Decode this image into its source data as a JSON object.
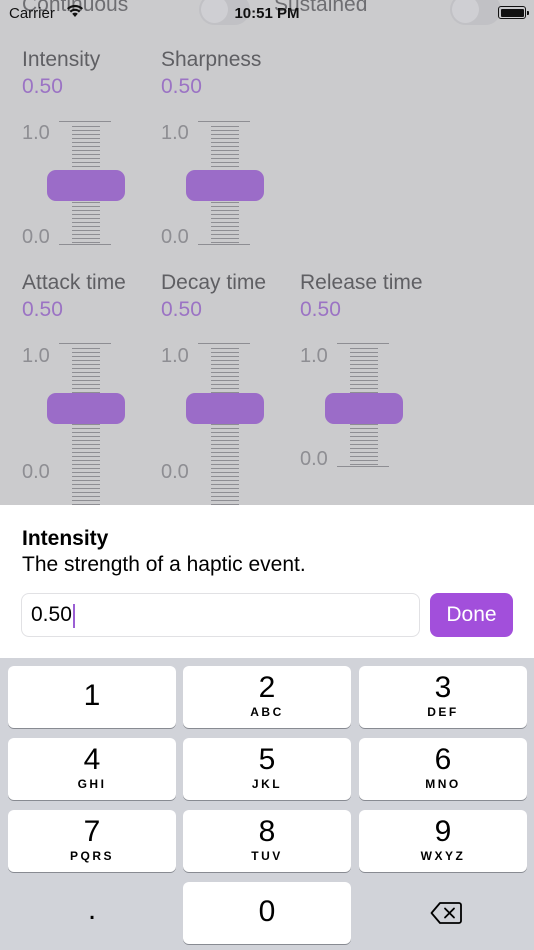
{
  "status": {
    "carrier": "Carrier",
    "time": "10:51 PM"
  },
  "modes": {
    "left": "Continuous",
    "right": "Sustained"
  },
  "params_row1": [
    {
      "name": "Intensity",
      "value": "0.50",
      "max": "1.0",
      "min": "0.0",
      "level": 0.5
    },
    {
      "name": "Sharpness",
      "value": "0.50",
      "max": "1.0",
      "min": "0.0",
      "level": 0.5
    }
  ],
  "params_row2": [
    {
      "name": "Attack time",
      "value": "0.50",
      "max": "1.0",
      "min": "0.0",
      "level": 0.5
    },
    {
      "name": "Decay time",
      "value": "0.50",
      "max": "1.0",
      "min": "0.0",
      "level": 0.5
    },
    {
      "name": "Release time",
      "value": "0.50",
      "max": "1.0",
      "min": "0.0",
      "level": 0.5
    }
  ],
  "sheet": {
    "title": "Intensity",
    "description": "The strength of a haptic event.",
    "input_value": "0.50",
    "done_label": "Done"
  },
  "keypad": [
    {
      "num": "1",
      "letters": ""
    },
    {
      "num": "2",
      "letters": "ABC"
    },
    {
      "num": "3",
      "letters": "DEF"
    },
    {
      "num": "4",
      "letters": "GHI"
    },
    {
      "num": "5",
      "letters": "JKL"
    },
    {
      "num": "6",
      "letters": "MNO"
    },
    {
      "num": "7",
      "letters": "PQRS"
    },
    {
      "num": "8",
      "letters": "TUV"
    },
    {
      "num": "9",
      "letters": "WXYZ"
    },
    {
      "num": ".",
      "letters": ""
    },
    {
      "num": "0",
      "letters": ""
    }
  ],
  "colors": {
    "accent": "#a24fdb",
    "thumb": "#9b6cc8",
    "value_text": "#9b73c4"
  },
  "icons": {
    "wifi": "wifi-icon",
    "battery": "battery-icon",
    "backspace": "backspace-icon"
  }
}
